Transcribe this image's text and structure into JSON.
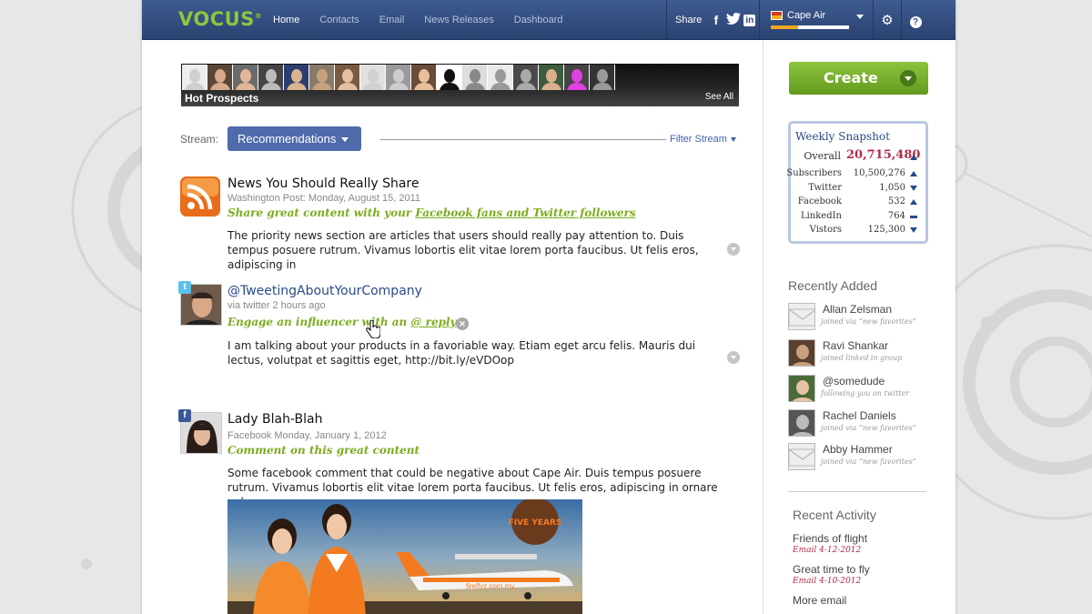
{
  "topbar": {
    "logo": "VOCUS",
    "logo_mark": "®",
    "nav": [
      "Home",
      "Contacts",
      "Email",
      "News Releases",
      "Dashboard"
    ],
    "share_label": "Share",
    "share_icons": [
      "facebook-icon",
      "twitter-icon",
      "linkedin-icon"
    ],
    "account_name": "Cape Air",
    "account_progress": 0.35
  },
  "hot_prospects": {
    "title": "Hot Prospects",
    "see_all": "See All",
    "avatar_count": 17
  },
  "stream": {
    "label": "Stream:",
    "selected": "Recommendations",
    "filter": "Filter Stream"
  },
  "posts": [
    {
      "icon": "rss-icon",
      "title": "News You Should Really Share",
      "meta": "Washington Post:  Monday, August 15, 2011",
      "cta_prefix": "Share great content with your ",
      "cta_link": "Facebook fans and Twitter followers",
      "body": "The priority news section are articles that users should really pay attention to. Duis tempus posuere rutrum. Vivamus lobortis elit vitae lorem porta faucibus. Ut felis eros, adipiscing in"
    },
    {
      "icon": "twitter-icon",
      "title": "@TweetingAboutYourCompany",
      "meta": "via twitter   2 hours ago",
      "cta_prefix": "Engage an influencer with an ",
      "cta_link": "@ reply",
      "body": "I am talking about your products in a favoriable way. Etiam eget arcu felis. Mauris dui lectus, volutpat et sagittis eget, http://bit.ly/eVDOop"
    },
    {
      "icon": "facebook-icon",
      "title": "Lady Blah-Blah",
      "meta": "Facebook  Monday, January 1, 2012",
      "cta_prefix": "Comment on this great content",
      "cta_link": "",
      "body": "Some facebook comment that could be negative about Cape Air. Duis tempus posuere rutrum. Vivamus lobortis elit vitae lorem porta faucibus. Ut felis eros, adipiscing in ornare vel,",
      "image_text": [
        "FIVE YEARS",
        "fireflyz.com.my"
      ]
    }
  ],
  "create_label": "Create",
  "snapshot": {
    "title": "Weekly Snapshot",
    "overall_label": "Overall",
    "overall_value": "20,715,480",
    "overall_trend": "up",
    "rows": [
      {
        "label": "Subscribers",
        "value": "10,500,276",
        "trend": "up"
      },
      {
        "label": "Twitter",
        "value": "1,050",
        "trend": "down"
      },
      {
        "label": "Facebook",
        "value": "532",
        "trend": "up"
      },
      {
        "label": "LinkedIn",
        "value": "764",
        "trend": "flat"
      },
      {
        "label": "Vistors",
        "value": "125,300",
        "trend": "down"
      }
    ]
  },
  "recently_added": {
    "title": "Recently Added",
    "items": [
      {
        "name": "Allan Zelsman",
        "sub": "joined via “new favorites”",
        "avatar": "mail"
      },
      {
        "name": "Ravi Shankar",
        "sub": "joined linked in group",
        "avatar": "photo"
      },
      {
        "name": "@somedude",
        "sub": "following you on twitter",
        "avatar": "photo"
      },
      {
        "name": "Rachel Daniels",
        "sub": "joined via “new favorites”",
        "avatar": "photo"
      },
      {
        "name": "Abby Hammer",
        "sub": "joined via “new favorites”",
        "avatar": "mail"
      }
    ]
  },
  "recent_activity": {
    "title": "Recent Activity",
    "items": [
      {
        "title": "Friends of flight",
        "sub": "Email 4-12-2012"
      },
      {
        "title": "Great time to fly",
        "sub": "Email 4-10-2012"
      },
      {
        "title": "More email",
        "sub": ""
      }
    ]
  },
  "colors": {
    "topbar": "#2f4a7d",
    "brand_green": "#8dc63f",
    "cta_green": "#7cac1e",
    "accent_red": "#b02c49",
    "stream_button": "#4f6bab"
  }
}
